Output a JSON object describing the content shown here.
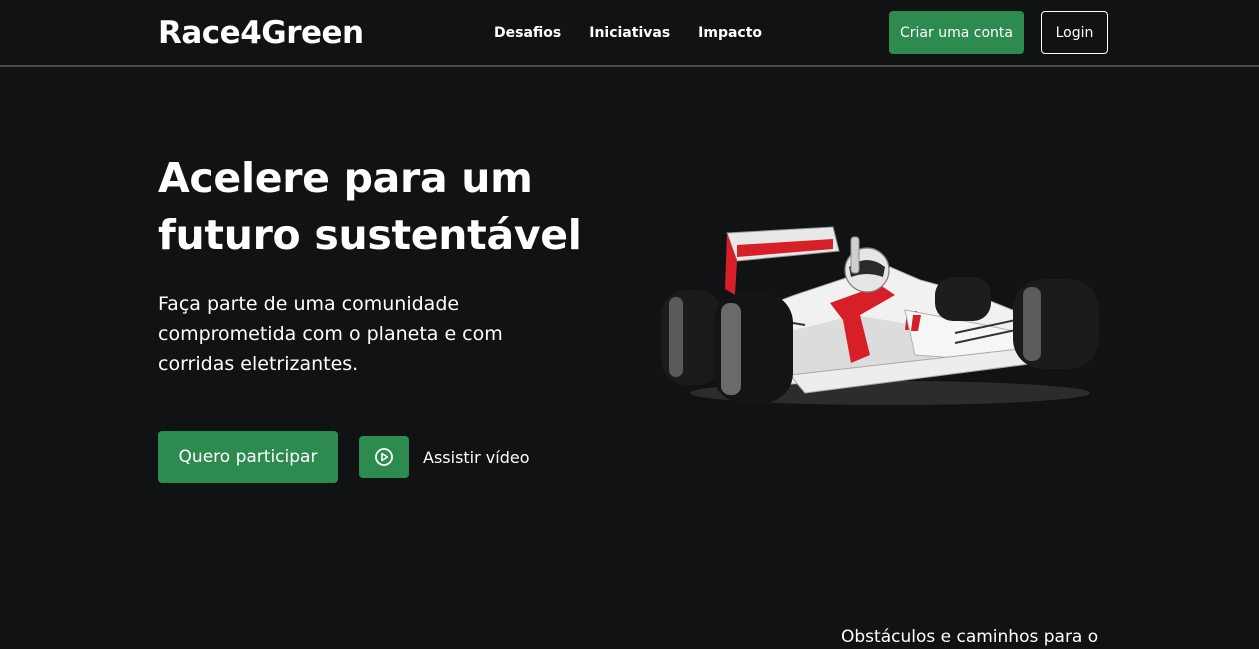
{
  "header": {
    "brand": "Race4Green",
    "nav": [
      "Desafios",
      "Iniciativas",
      "Impacto"
    ],
    "signup_label": "Criar uma conta",
    "login_label": "Login"
  },
  "hero": {
    "title_lines": [
      "Acelere para um",
      "futuro sustentável"
    ],
    "subtitle_lines": [
      "Faça parte de uma comunidade",
      "comprometida com o planeta e com",
      "corridas eletrizantes."
    ],
    "cta_label": "Quero participar",
    "play_icon": "play-circle-icon",
    "watch_label": "Assistir vídeo",
    "image": "formula-car-illustration"
  },
  "next_section": {
    "heading_partial": "Obstáculos e caminhos para o"
  },
  "colors": {
    "background": "#111213",
    "accent": "#2e8b50",
    "text": "#ffffff",
    "divider": "#4a4c4d"
  }
}
